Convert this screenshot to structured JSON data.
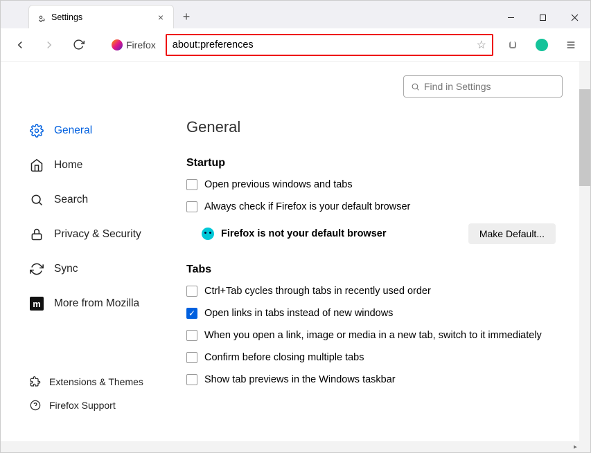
{
  "tab": {
    "title": "Settings"
  },
  "url": "about:preferences",
  "identity": "Firefox",
  "sidebar": {
    "general": "General",
    "home": "Home",
    "search": "Search",
    "privacy": "Privacy & Security",
    "sync": "Sync",
    "more": "More from Mozilla",
    "ext": "Extensions & Themes",
    "support": "Firefox Support"
  },
  "main": {
    "searchPlaceholder": "Find in Settings",
    "title": "General",
    "startup": {
      "heading": "Startup",
      "opt1": "Open previous windows and tabs",
      "opt2": "Always check if Firefox is your default browser",
      "notDefault": "Firefox is not your default browser",
      "makeDefault": "Make Default..."
    },
    "tabs": {
      "heading": "Tabs",
      "opt1": "Ctrl+Tab cycles through tabs in recently used order",
      "opt2": "Open links in tabs instead of new windows",
      "opt3": "When you open a link, image or media in a new tab, switch to it immediately",
      "opt4": "Confirm before closing multiple tabs",
      "opt5": "Show tab previews in the Windows taskbar"
    }
  }
}
